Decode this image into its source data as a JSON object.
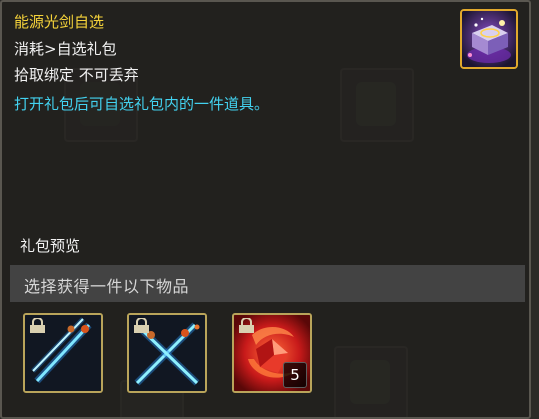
{
  "tooltip": {
    "title": "能源光剑自选",
    "type_line": "消耗>自选礼包",
    "binding_line": "拾取绑定 不可丢弃",
    "description": "打开礼包后可自选礼包内的一件道具。",
    "thumbnail_icon": "purple-gift-chest-icon",
    "preview_label": "礼包预览",
    "select_instruction": "选择获得一件以下物品",
    "items": [
      {
        "icon": "blue-crossed-lightsabers-icon",
        "locked": true,
        "count": ""
      },
      {
        "icon": "blue-crossed-lightsabers-icon",
        "locked": true,
        "count": ""
      },
      {
        "icon": "red-flame-crystal-icon",
        "locked": true,
        "count": "5"
      }
    ]
  },
  "colors": {
    "title": "#f5d33a",
    "description": "#43d2f0",
    "item_border": "#b9a45a",
    "thumbnail_border": "#e1a92c"
  }
}
